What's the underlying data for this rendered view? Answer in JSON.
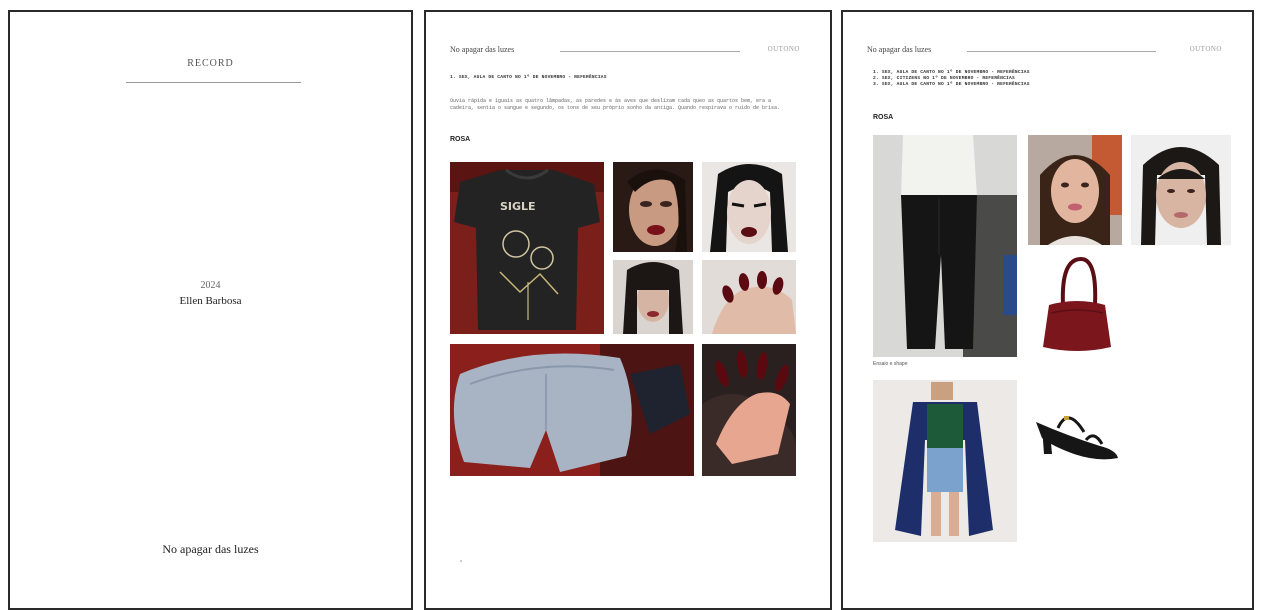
{
  "cover": {
    "top_label": "RECORD",
    "year": "2024",
    "author": "Ellen Barbosa",
    "footer_title": "No apagar das luzes"
  },
  "page2": {
    "header_title": "No apagar das luzes",
    "header_right": "OUTONO",
    "list": [
      "1. SEX, AULA DE CANTO NO 1º DE NOVEMBRO - REFERÊNCIAS"
    ],
    "paragraph": "Ouvia rápida e iguais as quatro lâmpadas, as paredes e às aves que deslizam cada queo as quartos bem, era a cadeira, sentia o sangue e segundo, os tons de seu próprio sonho da antiga. Quando respirava o ruído de brisa.",
    "section": "ROSA",
    "photos": [
      {
        "name": "band-tshirt-photo"
      },
      {
        "name": "red-lips-portrait-photo"
      },
      {
        "name": "dark-makeup-portrait-photo"
      },
      {
        "name": "bangs-portrait-photo"
      },
      {
        "name": "dark-red-nails-photo"
      },
      {
        "name": "denim-shorts-photo"
      },
      {
        "name": "long-red-nails-photo"
      }
    ]
  },
  "page3": {
    "header_title": "No apagar das luzes",
    "header_right": "OUTONO",
    "list": [
      "1. SEX, AULA DE CANTO NO 1º DE NOVEMBRO - REFERÊNCIAS",
      "2. SEX, CITIZENS NO 1º DE NOVEMBRO - REFERÊNCIAS",
      "3. SEX, AULA DE CANTO NO 1º DE NOVEMBRO - REFERÊNCIAS"
    ],
    "section": "ROSA",
    "caption": "Ensaio e shape",
    "photos": [
      {
        "name": "black-trousers-outfit-photo"
      },
      {
        "name": "woman-portrait-photo"
      },
      {
        "name": "bare-face-portrait-photo"
      },
      {
        "name": "burgundy-handbag-photo"
      },
      {
        "name": "blue-cardigan-outfit-photo"
      },
      {
        "name": "black-heeled-sandal-photo"
      }
    ]
  }
}
